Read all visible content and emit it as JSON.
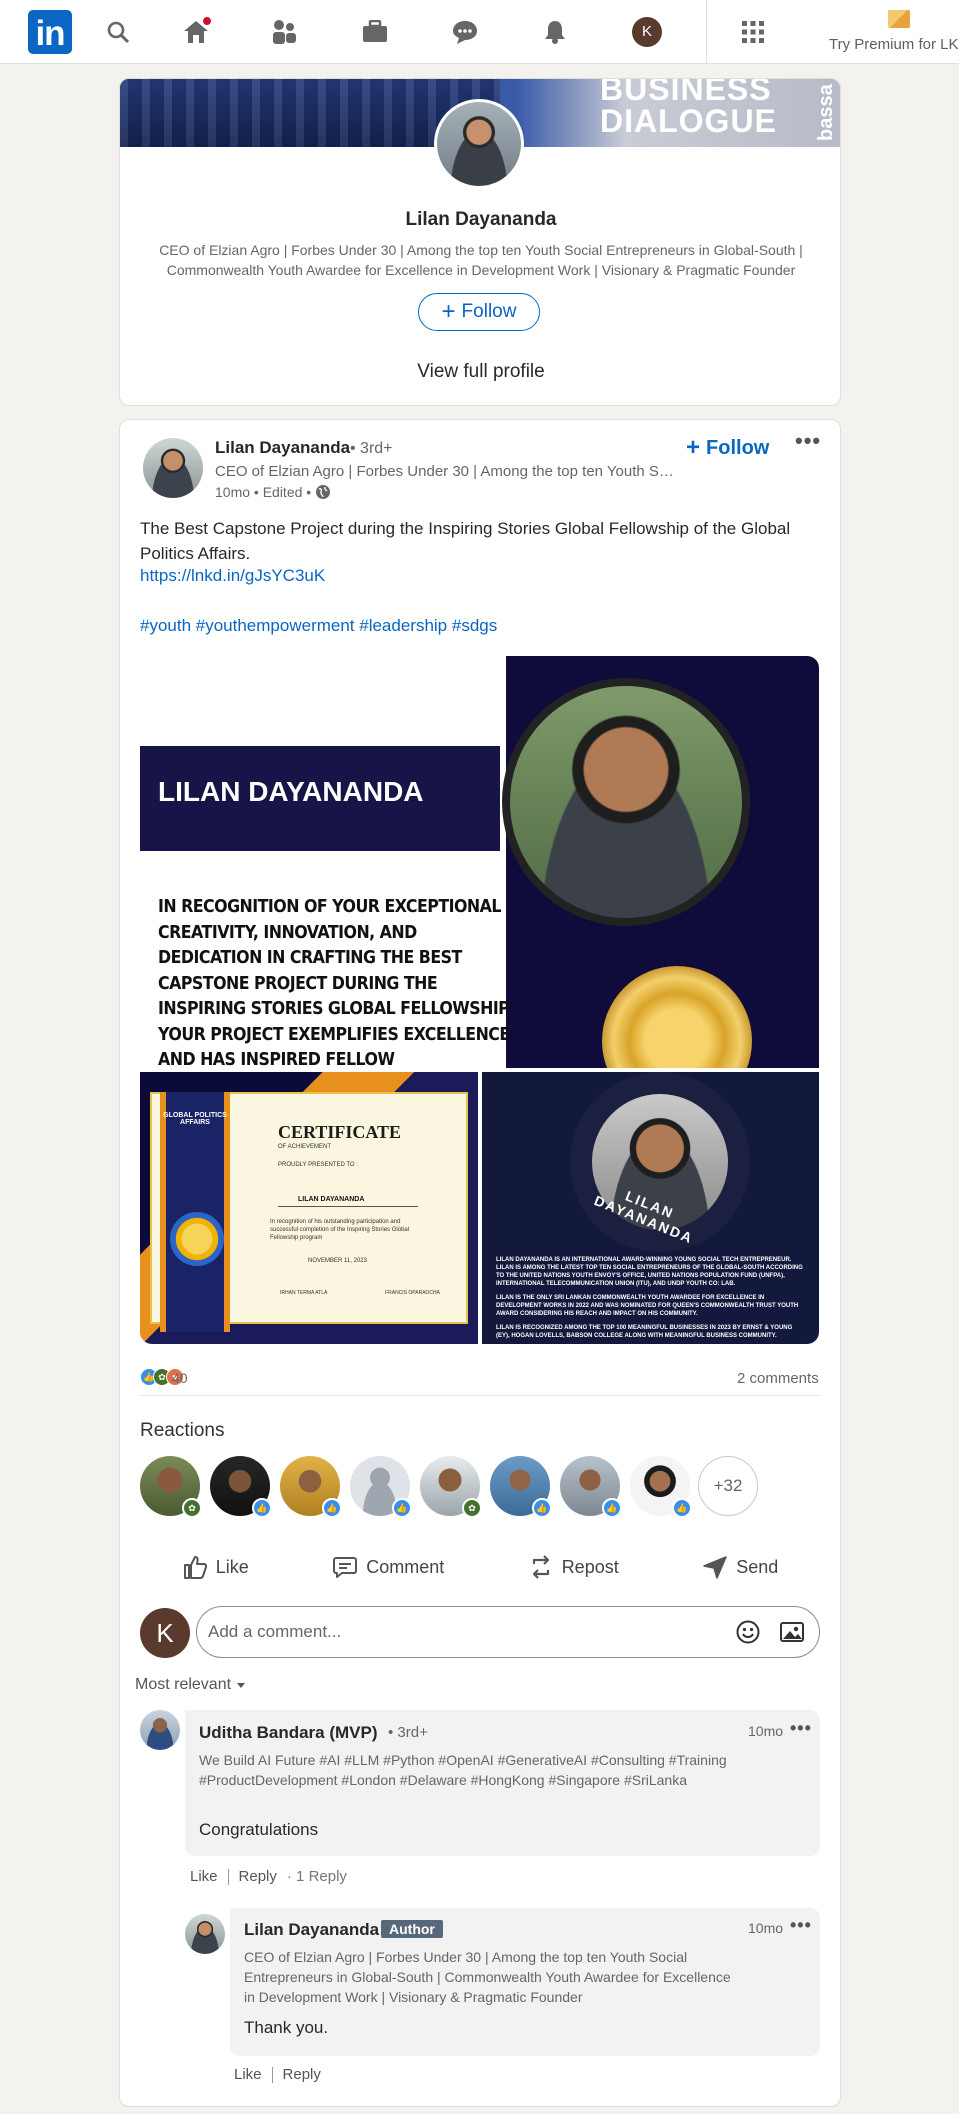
{
  "nav": {
    "logo": "in",
    "avatar_letter": "K",
    "premium": "Try Premium for LKR"
  },
  "profile_card": {
    "banner_line1": "BUSINESS",
    "banner_line2": "DIALOGUE",
    "banner_side": "bassa",
    "name": "Lilan Dayananda",
    "headline": "CEO of Elzian Agro | Forbes Under 30 | Among the top ten Youth Social Entrepreneurs in Global-South | Commonwealth Youth Awardee for Excellence in Development Work | Visionary & Pragmatic Founder",
    "follow": "Follow",
    "view_profile": "View full profile"
  },
  "post": {
    "author": "Lilan Dayananda",
    "degree": "• 3rd+",
    "subtitle": "CEO of Elzian Agro | Forbes Under 30 | Among the top ten Youth So...",
    "time": "10mo • Edited •",
    "follow": "Follow",
    "text": "The Best Capstone Project during the Inspiring Stories Global Fellowship of the Global Politics Affairs.",
    "link": "https://lnkd.in/gJsYC3uK",
    "hashtags": "#youth #youthempowerment #leadership #sdgs",
    "image1": {
      "name": "LILAN DAYANANDA",
      "recognition": "IN RECOGNITION OF YOUR EXCEPTIONAL CREATIVITY, INNOVATION, AND DEDICATION IN CRAFTING THE BEST CAPSTONE PROJECT DURING THE INSPIRING STORIES GLOBAL FELLOWSHIP. YOUR PROJECT EXEMPLIFIES EXCELLENCE AND HAS INSPIRED FELLOW PARTICIPANTS WITH ITS IMPACT AND POTENTIAL FOR POSITIVE CHANGE"
    },
    "image2": {
      "org": "GLOBAL POLITICS AFFAIRS",
      "title": "CERTIFICATE",
      "subtitle": "OF ACHIEVEMENT",
      "presented": "PROUDLY PRESENTED TO :",
      "recipient": "LILAN DAYANANDA",
      "body": "In recognition of his outstanding participation and successful completion of the Inspiring Stories Global Fellowship program",
      "date": "NOVEMBER 11, 2023",
      "sig1": "IRHAN TERMA ATLA",
      "sig2": "FRANCIS OPARAOCHA"
    },
    "image3": {
      "name": "LILAN DAYANANDA",
      "bio1": "LILAN DAYANANDA IS AN INTERNATIONAL AWARD-WINNING YOUNG SOCIAL TECH ENTREPRENEUR. LILAN IS AMONG THE LATEST TOP TEN SOCIAL ENTREPRENEURS OF THE GLOBAL-SOUTH ACCORDING TO THE UNITED NATIONS YOUTH ENVOY'S OFFICE, UNITED NATIONS POPULATION FUND (UNFPA), INTERNATIONAL TELECOMMUNICATION UNION (ITU), AND UNDP YOUTH CO: LAB.",
      "bio2": "LILAN IS THE ONLY SRI LANKAN COMMONWEALTH YOUTH AWARDEE FOR EXCELLENCE IN DEVELOPMENT WORKS IN 2022 AND WAS NOMINATED FOR QUEEN'S COMMONWEALTH TRUST YOUTH AWARD CONSIDERING HIS REACH AND IMPACT ON HIS COMMUNITY.",
      "bio3": "LILAN IS RECOGNIZED AMONG THE TOP 100 MEANINGFUL BUSINESSES IN 2023 BY ERNST & YOUNG (EY), HOGAN LOVELLS, BABSON COLLEGE ALONG WITH MEANINGFUL BUSINESS COMMUNITY."
    },
    "reaction_count": "40",
    "comment_count": "2 comments",
    "reactions_title": "Reactions",
    "more_reactors": "+32",
    "actions": {
      "like": "Like",
      "comment": "Comment",
      "repost": "Repost",
      "send": "Send"
    },
    "comment_avatar": "K",
    "comment_placeholder": "Add a comment...",
    "sort": "Most relevant"
  },
  "comments": [
    {
      "author": "Uditha Bandara (MVP)",
      "degree": "• 3rd+",
      "time": "10mo",
      "headline": "We Build AI Future #AI #LLM #Python #OpenAI #GenerativeAI #Consulting #Training #ProductDevelopment #London #Delaware #HongKong #Singapore #SriLanka",
      "body": "Congratulations",
      "like": "Like",
      "reply": "Reply",
      "replies": "· 1 Reply"
    },
    {
      "author": "Lilan Dayananda",
      "badge": "Author",
      "time": "10mo",
      "headline": "CEO of Elzian Agro | Forbes Under 30 | Among the top ten Youth Social Entrepreneurs in Global-South | Commonwealth Youth Awardee for Excellence in Development Work | Visionary & Pragmatic Founder",
      "body": "Thank you.",
      "like": "Like",
      "reply": "Reply"
    }
  ],
  "colors": {
    "brand": "#0a66c2",
    "notification": "#cb112d",
    "like_badge": "#378fe9",
    "author_badge": "#56687a"
  },
  "icons": [
    "search-icon",
    "home-icon",
    "people-icon",
    "briefcase-icon",
    "messaging-icon",
    "bell-icon",
    "apps-grid-icon",
    "globe-icon",
    "more-icon",
    "like-icon",
    "comment-icon",
    "repost-icon",
    "send-icon",
    "emoji-icon",
    "image-icon",
    "caret-down-icon"
  ]
}
